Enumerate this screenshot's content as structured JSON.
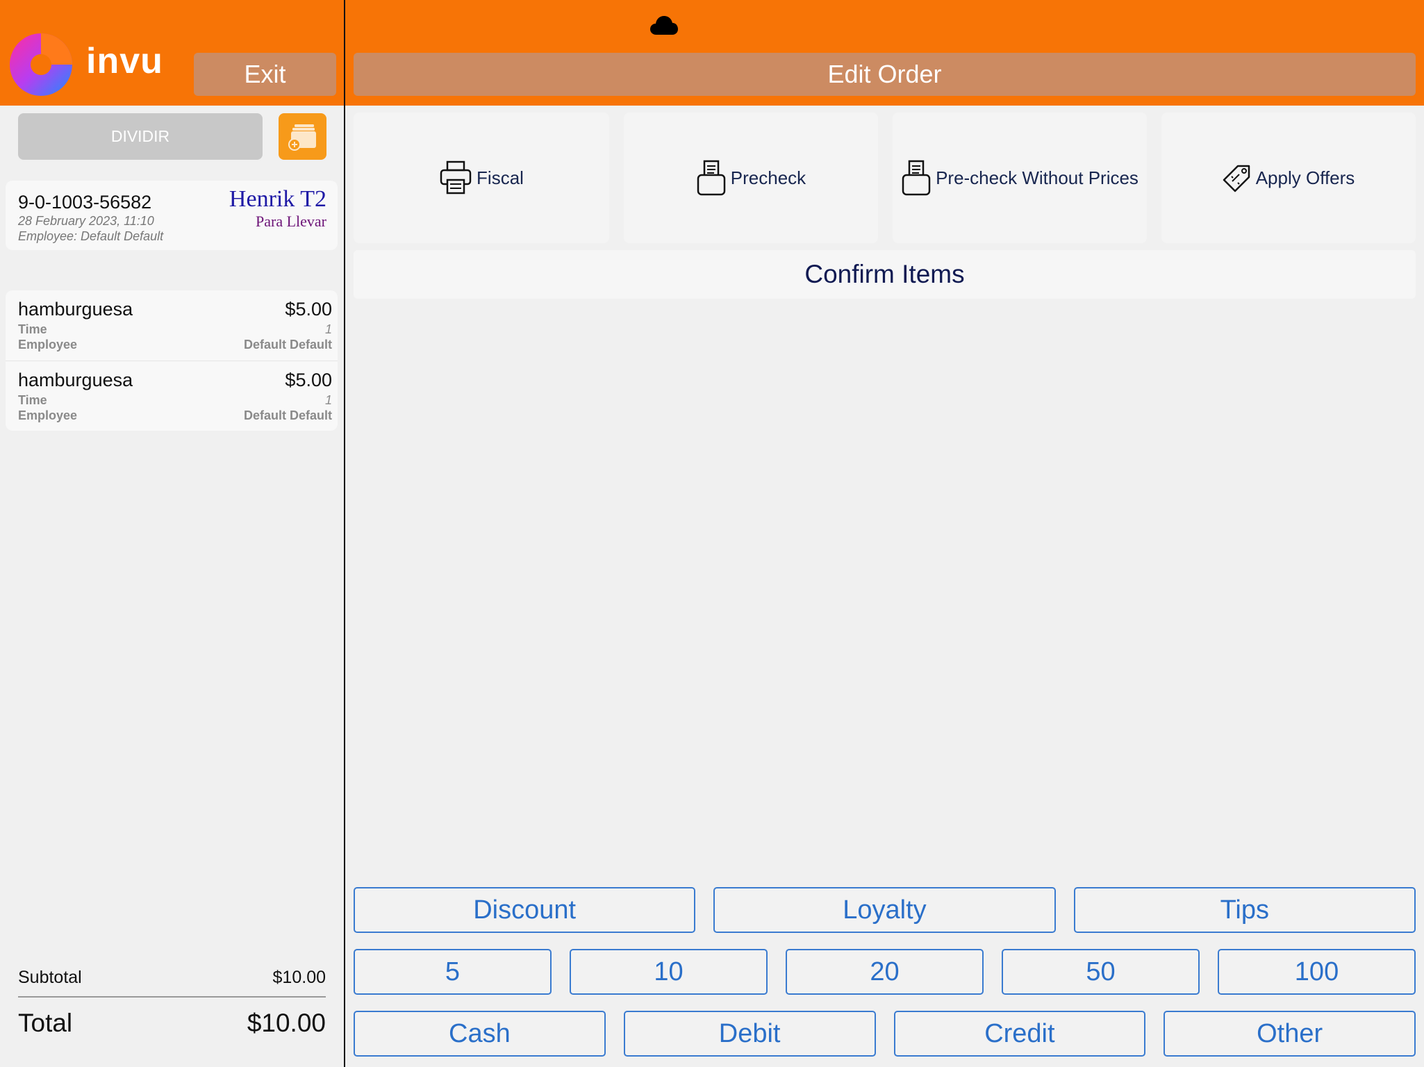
{
  "brand": {
    "name": "invu",
    "accent": "#f77406",
    "header_button_bg": "#cc8b62"
  },
  "left": {
    "exit_label": "Exit",
    "split_label": "DIVIDIR",
    "order": {
      "number": "9-0-1003-56582",
      "date": "28 February 2023, 11:10",
      "employee": "Employee: Default Default",
      "customer": "Henrik T2",
      "type": "Para Llevar"
    },
    "items": [
      {
        "name": "hamburguesa",
        "price": "$5.00",
        "time_label": "Time",
        "time_value": "1",
        "employee_label": "Employee",
        "employee_value": "Default Default"
      },
      {
        "name": "hamburguesa",
        "price": "$5.00",
        "time_label": "Time",
        "time_value": "1",
        "employee_label": "Employee",
        "employee_value": "Default Default"
      }
    ],
    "totals": {
      "subtotal_label": "Subtotal",
      "subtotal_value": "$10.00",
      "total_label": "Total",
      "total_value": "$10.00"
    }
  },
  "right": {
    "title": "Edit Order",
    "status_icon": "cloud-icon",
    "actions": [
      {
        "label": "Fiscal",
        "icon": "printer-icon"
      },
      {
        "label": "Precheck",
        "icon": "receipt-printer-icon"
      },
      {
        "label": "Pre-check Without Prices",
        "icon": "receipt-printer-icon"
      },
      {
        "label": "Apply Offers",
        "icon": "price-tag-icon"
      }
    ],
    "confirm_label": "Confirm Items",
    "modifiers": [
      "Discount",
      "Loyalty",
      "Tips"
    ],
    "amounts": [
      "5",
      "10",
      "20",
      "50",
      "100"
    ],
    "payments": [
      "Cash",
      "Debit",
      "Credit",
      "Other"
    ]
  }
}
